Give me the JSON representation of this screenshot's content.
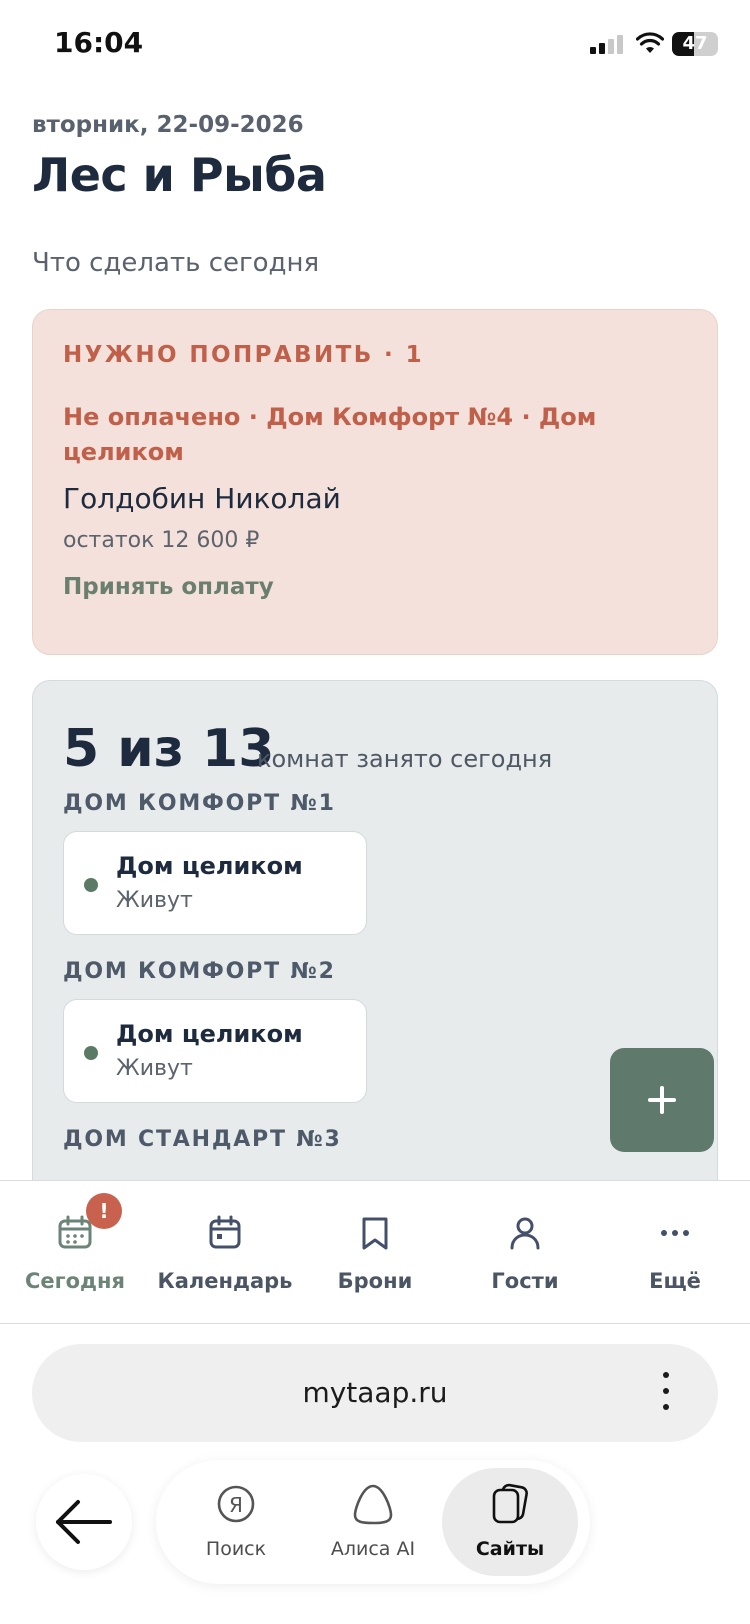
{
  "status_bar": {
    "time": "16:04",
    "battery": "47",
    "battery_level": 0.47
  },
  "header": {
    "date": "вторник, 22-09-2026",
    "title": "Лес и Рыба",
    "subtitle": "Что сделать сегодня"
  },
  "alert": {
    "heading": "НУЖНО ПОПРАВИТЬ · 1",
    "issue": "Не оплачено · Дом Комфорт №4 · Дом целиком",
    "guest": "Голдобин Николай",
    "balance": "остаток 12 600 ₽",
    "action": "Принять оплату"
  },
  "occupancy": {
    "count": "5 из 13",
    "caption": "комнат занято сегодня",
    "groups": [
      {
        "title": "ДОМ КОМФОРТ №1",
        "rooms": [
          {
            "type": "Дом целиком",
            "status": "Живут"
          }
        ]
      },
      {
        "title": "ДОМ КОМФОРТ №2",
        "rooms": [
          {
            "type": "Дом целиком",
            "status": "Живут"
          }
        ]
      },
      {
        "title": "ДОМ СТАНДАРТ №3",
        "rooms": []
      }
    ]
  },
  "fab": {
    "icon": "plus-icon"
  },
  "nav": {
    "items": [
      {
        "label": "Сегодня",
        "icon": "calendar-today-icon",
        "badge": "!"
      },
      {
        "label": "Календарь",
        "icon": "calendar-icon"
      },
      {
        "label": "Брони",
        "icon": "bookmark-icon"
      },
      {
        "label": "Гости",
        "icon": "person-icon"
      },
      {
        "label": "Ещё",
        "icon": "more-icon"
      }
    ]
  },
  "browser": {
    "url": "mytaap.ru",
    "tabs": [
      {
        "label": "Поиск",
        "icon": "yandex-search-icon"
      },
      {
        "label": "Алиса AI",
        "icon": "alice-icon"
      },
      {
        "label": "Сайты",
        "icon": "sites-icon",
        "active": true
      }
    ]
  },
  "colors": {
    "alert_bg": "#f4e1db",
    "alert_text": "#c0604a",
    "accent_green": "#5f7a6d",
    "badge": "#c8624e"
  }
}
